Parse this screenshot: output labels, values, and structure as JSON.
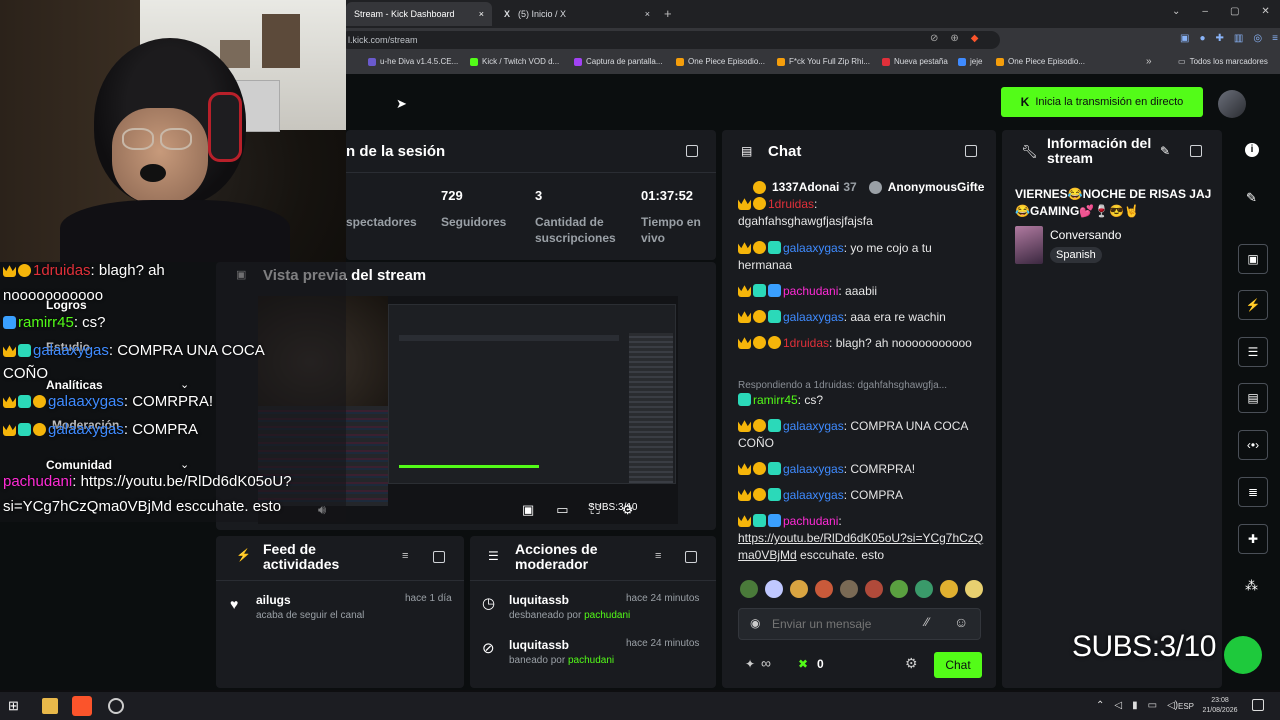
{
  "browser": {
    "tabs": [
      {
        "label": "Stream - Kick Dashboard",
        "close": "×"
      },
      {
        "label": "(5) Inicio / X",
        "close": "×"
      }
    ],
    "new_tab": "+",
    "url": "l.kick.com/stream",
    "bookmarks": [
      {
        "label": "u-he Diva v1.4.5.CE..."
      },
      {
        "label": "Kick / Twitch VOD d..."
      },
      {
        "label": "Captura de pantalla..."
      },
      {
        "label": "One Piece Episodio..."
      },
      {
        "label": "F*ck You Full Zip Rhi..."
      },
      {
        "label": "Nueva pestaña"
      },
      {
        "label": "jeje"
      },
      {
        "label": "One Piece Episodio..."
      }
    ],
    "bookmarks_more": "»",
    "all_bookmarks": "Todos los marcadores"
  },
  "dashboard": {
    "go_live_button": "Inicia la transmisión en directo",
    "session": {
      "title": "n de la sesión",
      "stats": [
        {
          "value": "",
          "label": "spectadores"
        },
        {
          "value": "729",
          "label": "Seguidores"
        },
        {
          "value": "3",
          "label": "Cantidad de suscripciones"
        },
        {
          "value": "01:37:52",
          "label": "Tiempo en vivo"
        }
      ]
    },
    "preview": {
      "title": "Vista previa del stream",
      "overlay_text": "SUBS:3/10"
    },
    "left_menu": [
      {
        "label": "Logros"
      },
      {
        "label": "Estudio"
      },
      {
        "label": "Analíticas"
      },
      {
        "label": "Moderación"
      },
      {
        "label": "Comunidad"
      }
    ],
    "activity": {
      "title": "Feed de actividades",
      "items": [
        {
          "user": "ailugs",
          "time": "hace 1 día",
          "desc": "acaba de seguir el canal"
        }
      ]
    },
    "mod": {
      "title": "Acciones de moderador",
      "items": [
        {
          "user": "luquitassb",
          "time": "hace 24 minutos",
          "desc": "desbaneado por",
          "by": "pachudani"
        },
        {
          "user": "luquitassb",
          "time": "hace 24 minutos",
          "desc": "baneado por",
          "by": "pachudani"
        }
      ]
    },
    "chat": {
      "title": "Chat",
      "top": {
        "user1": "1337Adonai",
        "count1": "37",
        "user2": "AnonymousGifte"
      },
      "messages": [
        {
          "user": "1druidas",
          "text": "dgahfahsghawgfjasjfajsfa"
        },
        {
          "user": "galaaxygas",
          "text": ": yo me cojo a tu hermanaa"
        },
        {
          "user": "pachudani",
          "text": ": aaabii"
        },
        {
          "user": "galaaxygas",
          "text": ": aaa era re wachin"
        },
        {
          "user": "1druidas",
          "text": ": blagh? ah nooooooooooo"
        },
        {
          "reply": "Respondiendo a 1druidas: dgahfahsghawgfja..."
        },
        {
          "user": "ramirr45",
          "text": ": cs?"
        },
        {
          "user": "galaaxygas",
          "text": ": COMPRA UNA COCA COÑO"
        },
        {
          "user": "galaaxygas",
          "text": ": COMRPRA!"
        },
        {
          "user": "galaaxygas",
          "text": ": COMPRA"
        },
        {
          "user": "pachudani",
          "text": ":",
          "link": "https://youtu.be/RlDd6dK05oU?si=YCg7hCzQma0VBjMd",
          "tail": " esccuhate. esto"
        }
      ],
      "input_placeholder": "Enviar un mensaje",
      "footer": {
        "infinity": "∞",
        "zero": "0",
        "send": "Chat"
      }
    },
    "info": {
      "title": "Información del stream",
      "stream_title": "VIERNES😂NOCHE DE RISAS JAJ😂GAMING💕🍷😎🤘",
      "category": "Conversando",
      "language": "Spanish"
    }
  },
  "webcam_overlay": {
    "lines": [
      {
        "user": "1druidas",
        "text": ": blagh? ah"
      },
      {
        "text": "nooooooooooo"
      },
      {
        "user": "ramirr45",
        "text": ": cs?"
      },
      {
        "user": "galaaxygas",
        "text": ": COMPRA UNA COCA"
      },
      {
        "text": "COÑO"
      },
      {
        "user": "galaaxygas",
        "text": ": COMRPRA!"
      },
      {
        "user": "galaaxygas",
        "text": ": COMPRA"
      },
      {
        "user": "pachudani",
        "text": ": https://youtu.be/RlDd6dK05oU?"
      },
      {
        "text": "si=YCg7hCzQma0VBjMd esccuhate. esto"
      }
    ],
    "subs_text": "SUBS:3/10"
  },
  "taskbar": {
    "lang": "ESP",
    "time": "23:08",
    "date": "21/08/2026"
  },
  "colors": {
    "kick_green": "#53fc18",
    "panel": "#191b1f",
    "bg": "#0b0e0f"
  }
}
